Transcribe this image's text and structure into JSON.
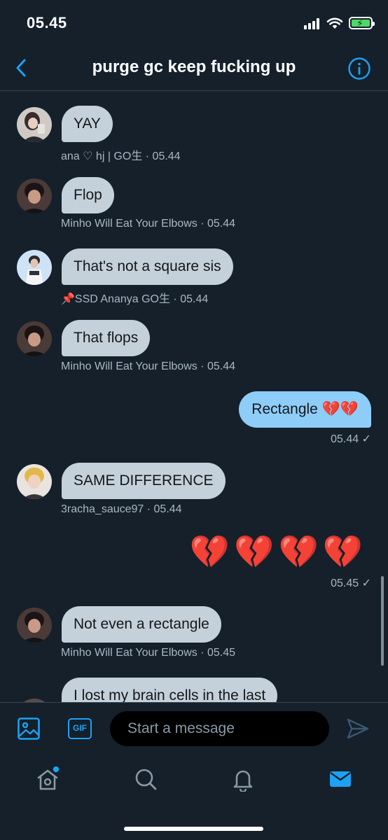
{
  "status_bar": {
    "time": "05.45"
  },
  "header": {
    "title": "purge gc keep fucking up"
  },
  "messages": [
    {
      "text": "YAY",
      "meta": "ana ♡ hj | GO生  · 05.44"
    },
    {
      "text": "Flop",
      "meta": "Minho Will Eat Your Elbows  · 05.44"
    },
    {
      "text": "That's not a square sis",
      "meta": "📌SSD Ananya GO生  · 05.44"
    },
    {
      "text": "That flops",
      "meta": "Minho Will Eat Your Elbows  · 05.44"
    },
    {
      "text": "Rectangle 💔💔",
      "meta": "05.44 ✓"
    },
    {
      "text": "SAME DIFFERENCE",
      "meta": "3racha_sauce97  · 05.44"
    },
    {
      "text": "💔💔💔💔",
      "meta": "05.45 ✓"
    },
    {
      "text": "Not even a rectangle",
      "meta": "Minho Will Eat Your Elbows  · 05.45"
    },
    {
      "text": "I lost my brain cells in the last"
    }
  ],
  "composer": {
    "gif_label": "GIF",
    "placeholder": "Start a message"
  },
  "colors": {
    "background": "#15202b",
    "accent": "#1da1f2",
    "incoming_bubble": "#c5d1da",
    "outgoing_bubble": "#8ecdf8",
    "divider": "#38444d"
  },
  "icons": {
    "back": "chevron-left-icon",
    "info": "info-circle-icon",
    "media": "image-icon",
    "send": "send-icon",
    "tabs": [
      "home-icon",
      "search-icon",
      "bell-icon",
      "mail-icon"
    ]
  }
}
